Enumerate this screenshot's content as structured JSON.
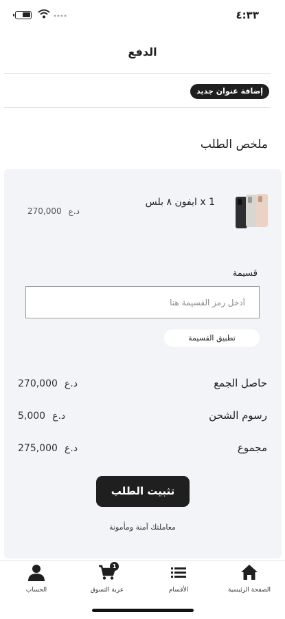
{
  "status_bar": {
    "time": "٤:٣٣",
    "battery_level": 0.6
  },
  "header": {
    "title": "الدفع"
  },
  "address": {
    "add_button_label": "إضافة عنوان جديد"
  },
  "summary": {
    "section_title": "ملخص الطلب",
    "product": {
      "name": "1 x ايفون ٨ بلس",
      "price": "270,000",
      "currency": "د.ع",
      "image_icon": "iphone-product-image"
    },
    "coupon": {
      "label": "قسيمة",
      "placeholder": "أدخل رمز القسيمة هنا",
      "value": "",
      "apply_label": "تطبيق القسيمة"
    },
    "rows": [
      {
        "label": "حاصل الجمع",
        "value": "270,000",
        "currency": "د.ع"
      },
      {
        "label": "رسوم الشحن",
        "value": "5,000",
        "currency": "د.ع"
      },
      {
        "label": "مجموع",
        "value": "275,000",
        "currency": "د.ع"
      }
    ],
    "confirm_label": "تثبيت الطلب",
    "secure_note": "معاملتك آمنة ومأمونة"
  },
  "tab_bar": {
    "items": [
      {
        "label": "الصفحة الرئيسية",
        "icon": "home-icon"
      },
      {
        "label": "الأقسام",
        "icon": "list-icon"
      },
      {
        "label": "عربة التسوق",
        "icon": "cart-icon",
        "badge": "1"
      },
      {
        "label": "الحساب",
        "icon": "user-icon"
      }
    ]
  },
  "colors": {
    "primary": "#1f1f1f",
    "card_background": "#f2f4f7",
    "background": "#ffffff"
  }
}
